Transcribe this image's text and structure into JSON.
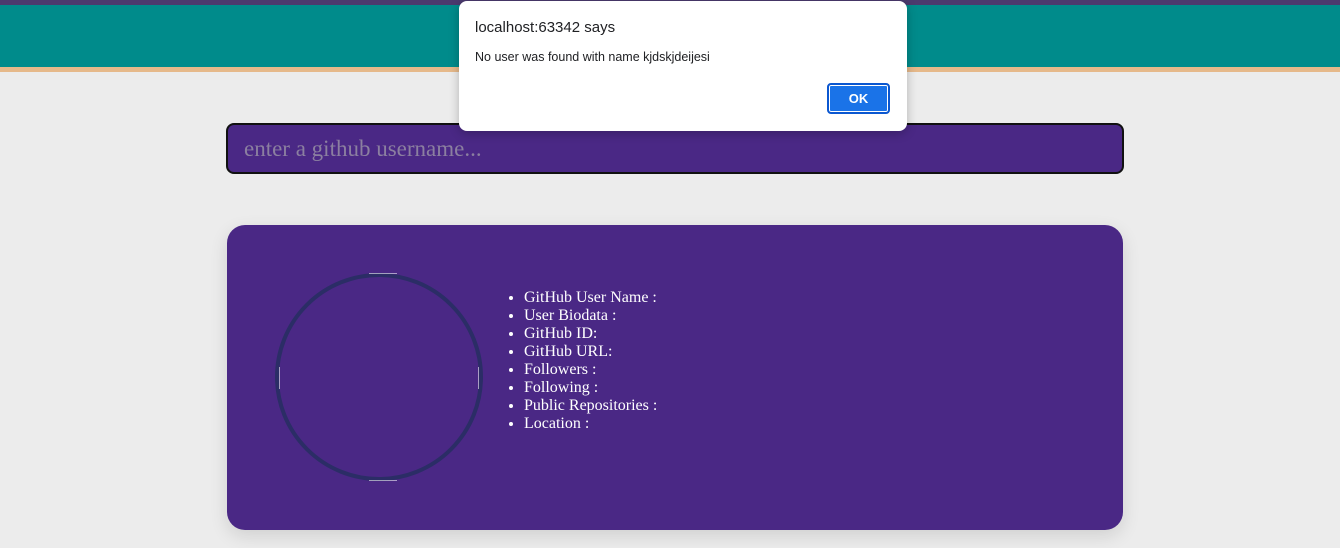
{
  "search": {
    "placeholder": "enter a github username..."
  },
  "profile": {
    "items": [
      "GitHub User Name :",
      "User Biodata :",
      "GitHub ID:",
      "GitHub URL:",
      "Followers :",
      "Following :",
      "Public Repositories :",
      "Location :"
    ]
  },
  "alert": {
    "title": "localhost:63342 says",
    "message": "No user was found with name kjdskjdeijesi",
    "ok_label": "OK"
  },
  "colors": {
    "header": "#008b8b",
    "header_border": "#e6b98a",
    "card": "#4a2885",
    "background": "#ececec",
    "ok_button": "#1a73e8"
  }
}
